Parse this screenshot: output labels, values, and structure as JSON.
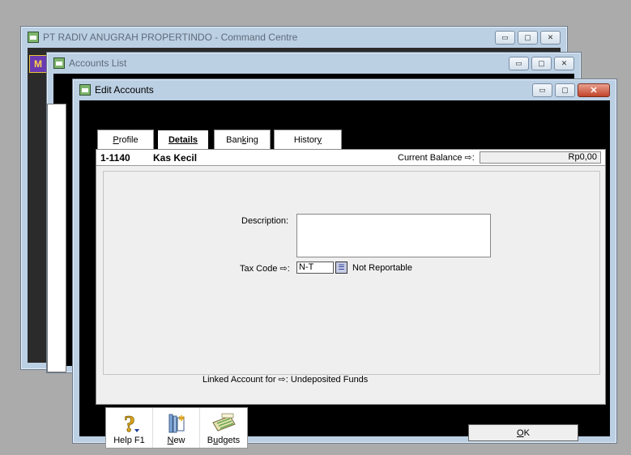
{
  "windows": {
    "command_centre": {
      "title": "PT RADIV ANUGRAH PROPERTINDO - Command Centre"
    },
    "accounts_list": {
      "title": "Accounts List"
    },
    "edit_accounts": {
      "title": "Edit Accounts"
    }
  },
  "tabs": [
    {
      "label": "Profile",
      "accel": "P",
      "rest": "rofile",
      "active": false
    },
    {
      "label": "Details",
      "accel": "D",
      "rest": "etails",
      "active": true
    },
    {
      "label": "Banking",
      "pre": "Ban",
      "accel": "k",
      "rest": "ing",
      "active": false
    },
    {
      "label": "History",
      "pre": "Histor",
      "accel": "y",
      "active": false
    }
  ],
  "account": {
    "number": "1-1140",
    "name": "Kas Kecil",
    "current_balance_label": "Current Balance ⇨:",
    "current_balance": "Rp0,00"
  },
  "form": {
    "description_label": "Description:",
    "description_value": "",
    "tax_code_label": "Tax Code ⇨:",
    "tax_code_value": "N-T",
    "tax_code_desc": "Not Reportable",
    "linked_account_label": "Linked Account for ⇨:",
    "linked_account_value": "Undeposited Funds"
  },
  "toolbar": {
    "help": {
      "pre": "Help F1"
    },
    "new": {
      "accel": "N",
      "rest": "ew"
    },
    "budgets": {
      "pre": "B",
      "accel": "u",
      "rest": "dgets"
    }
  },
  "ok_button": {
    "accel": "O",
    "rest": "K"
  },
  "icons": {
    "help": "question-mark-icon",
    "new": "new-document-icon",
    "budgets": "budget-sheet-icon"
  }
}
